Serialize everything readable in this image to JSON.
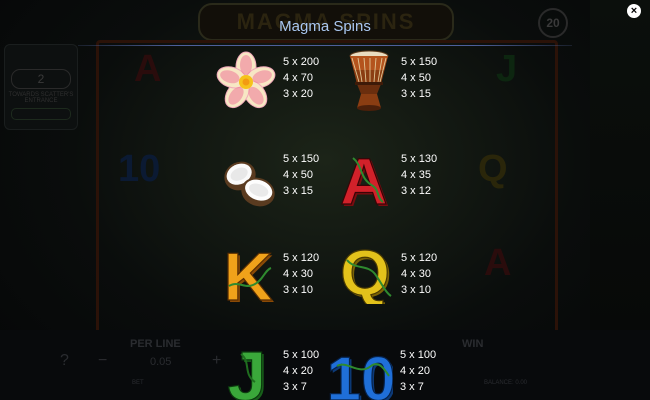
{
  "background": {
    "game_title": "MAGMA SPINS",
    "bet_lines": "20",
    "side_value": "2",
    "side_text": "TOWARDS SCATTER'S ENTRANCE",
    "ghost_symbols": [
      "A",
      "10",
      "Q",
      "J",
      "A"
    ],
    "bottom": {
      "per_line_label": "PER LINE",
      "per_line_value": "0.05",
      "win_label": "WIN",
      "help": "?",
      "minus": "−",
      "plus": "+",
      "bet_small": "BET",
      "balance_small": "BALANCE: 0.00"
    }
  },
  "header": {
    "title": "Magma Spins",
    "close_label": "×"
  },
  "paytable": [
    {
      "symbol": "flower-icon",
      "payouts": [
        "5 x 200",
        "4 x 70",
        "3 x 20"
      ]
    },
    {
      "symbol": "drum-icon",
      "payouts": [
        "5 x 150",
        "4 x 50",
        "3 x 15"
      ]
    },
    {
      "symbol": "coconut-icon",
      "payouts": [
        "5 x 150",
        "4 x 50",
        "3 x 15"
      ]
    },
    {
      "symbol": "letter-a-icon",
      "label": "A",
      "payouts": [
        "5 x 130",
        "4 x 35",
        "3 x 12"
      ]
    },
    {
      "symbol": "letter-k-icon",
      "label": "K",
      "payouts": [
        "5 x 120",
        "4 x 30",
        "3 x 10"
      ]
    },
    {
      "symbol": "letter-q-icon",
      "label": "Q",
      "payouts": [
        "5 x 120",
        "4 x 30",
        "3 x 10"
      ]
    },
    {
      "symbol": "letter-j-icon",
      "label": "J",
      "payouts": [
        "5 x 100",
        "4 x 20",
        "3 x 7"
      ]
    },
    {
      "symbol": "number-10-icon",
      "label": "10",
      "payouts": [
        "5 x 100",
        "4 x 20",
        "3 x 7"
      ]
    }
  ],
  "colors": {
    "title": "#a9c7f0",
    "rule": "#4e5f9a",
    "a_red": "#d2212a",
    "k_orange": "#f0a21a",
    "q_yellow": "#e3c21b",
    "j_green": "#3aa83a",
    "ten_blue": "#1f6fd8"
  }
}
